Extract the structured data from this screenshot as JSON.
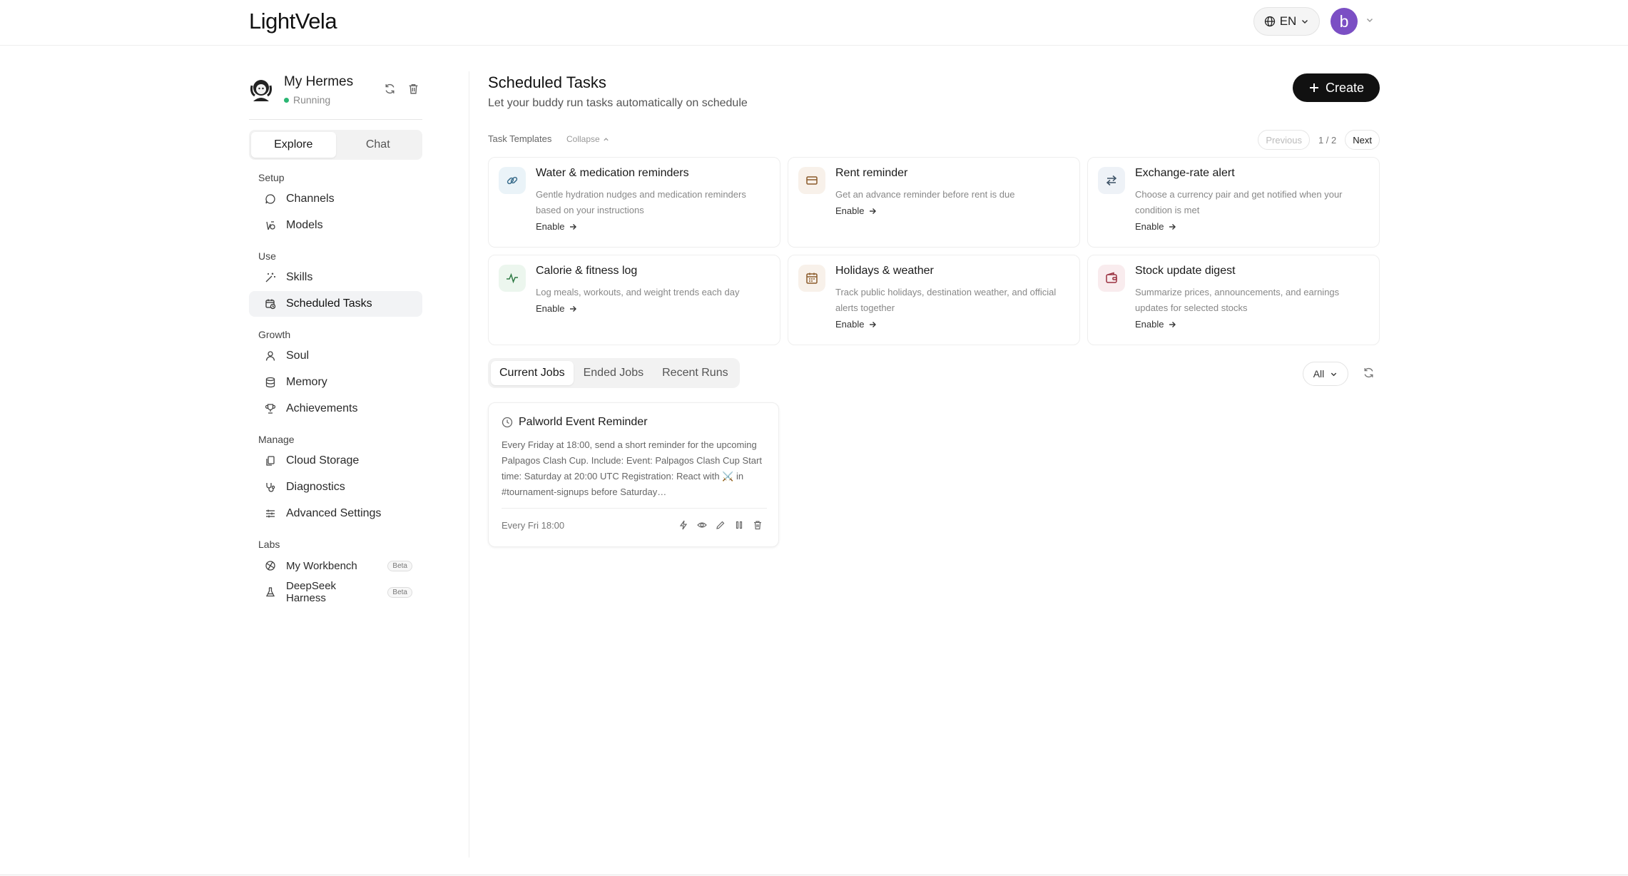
{
  "app": {
    "logo": "LightVela"
  },
  "topbar": {
    "language": "EN",
    "avatar_letter": "b"
  },
  "profile": {
    "name": "My Hermes",
    "status": "Running"
  },
  "sidebar": {
    "tabs": [
      {
        "label": "Explore",
        "active": true
      },
      {
        "label": "Chat",
        "active": false
      }
    ],
    "groups": [
      {
        "title": "Setup",
        "items": [
          {
            "label": "Channels",
            "icon": "chat-bubble-icon"
          },
          {
            "label": "Models",
            "icon": "models-icon"
          }
        ]
      },
      {
        "title": "Use",
        "items": [
          {
            "label": "Skills",
            "icon": "magic-wand-icon"
          },
          {
            "label": "Scheduled Tasks",
            "icon": "calendar-clock-icon",
            "active": true
          }
        ]
      },
      {
        "title": "Growth",
        "items": [
          {
            "label": "Soul",
            "icon": "person-icon"
          },
          {
            "label": "Memory",
            "icon": "database-icon"
          },
          {
            "label": "Achievements",
            "icon": "trophy-icon"
          }
        ]
      },
      {
        "title": "Manage",
        "items": [
          {
            "label": "Cloud Storage",
            "icon": "files-icon"
          },
          {
            "label": "Diagnostics",
            "icon": "stethoscope-icon"
          },
          {
            "label": "Advanced Settings",
            "icon": "sliders-icon"
          }
        ]
      },
      {
        "title": "Labs",
        "items": [
          {
            "label": "My Workbench",
            "icon": "workbench-icon",
            "badge": "Beta"
          },
          {
            "label": "DeepSeek Harness",
            "icon": "flask-icon",
            "badge": "Beta"
          }
        ]
      }
    ]
  },
  "main": {
    "title": "Scheduled Tasks",
    "subtitle": "Let your buddy run tasks automatically on schedule",
    "create_label": "Create",
    "templates_label": "Task Templates",
    "collapse_label": "Collapse",
    "pager": {
      "previous": "Previous",
      "info": "1 / 2",
      "next": "Next"
    },
    "enable_label": "Enable",
    "templates": [
      {
        "title": "Water & medication reminders",
        "desc": "Gentle hydration nudges and medication reminders based on your instructions",
        "icon": "link-icon",
        "color": "#eaf3f8"
      },
      {
        "title": "Rent reminder",
        "desc": "Get an advance reminder before rent is due",
        "icon": "card-icon",
        "color": "#f8f1ea"
      },
      {
        "title": "Exchange-rate alert",
        "desc": "Choose a currency pair and get notified when your condition is met",
        "icon": "swap-icon",
        "color": "#eef2f7"
      },
      {
        "title": "Calorie & fitness log",
        "desc": "Log meals, workouts, and weight trends each day",
        "icon": "activity-icon",
        "color": "#ecf6ee"
      },
      {
        "title": "Holidays & weather",
        "desc": "Track public holidays, destination weather, and official alerts together",
        "icon": "calendar-icon",
        "color": "#f8f1ea"
      },
      {
        "title": "Stock update digest",
        "desc": "Summarize prices, announcements, and earnings updates for selected stocks",
        "icon": "wallet-icon",
        "color": "#f9ecee"
      }
    ],
    "job_tabs": [
      {
        "label": "Current Jobs",
        "active": true
      },
      {
        "label": "Ended Jobs"
      },
      {
        "label": "Recent Runs"
      }
    ],
    "filter_value": "All",
    "jobs": [
      {
        "title": "Palworld Event Reminder",
        "desc": "Every Friday at 18:00, send a short reminder for the upcoming Palpagos Clash Cup. Include: Event: Palpagos Clash Cup Start time: Saturday at 20:00 UTC Registration: React with ⚔️ in #tournament-signups before Saturday…",
        "schedule": "Every Fri 18:00"
      }
    ]
  },
  "colors": {
    "accent": "#111111",
    "avatar": "#7b4fc4",
    "running": "#2bb673"
  }
}
